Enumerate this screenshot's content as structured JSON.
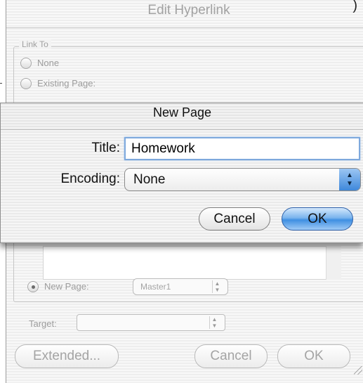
{
  "back_dialog": {
    "title": "Edit Hyperlink",
    "link_to_label": "Link To",
    "options": [
      {
        "label": "None",
        "selected": false
      },
      {
        "label": "Existing Page:",
        "selected": false
      },
      {
        "label": "New Page:",
        "selected": true
      }
    ],
    "master_popup_value": "Master1",
    "target_label": "Target:",
    "target_value": "",
    "extended_label": "Extended...",
    "cancel_label": "Cancel",
    "ok_label": "OK",
    "paren_glyph": ")"
  },
  "sheet": {
    "title": "New Page",
    "title_label": "Title:",
    "title_value": "Homework",
    "encoding_label": "Encoding:",
    "encoding_value": "None",
    "cancel_label": "Cancel",
    "ok_label": "OK"
  },
  "colors": {
    "ok_button_accent": "#3f8fe2",
    "focus_ring": "#7ea9dd"
  }
}
